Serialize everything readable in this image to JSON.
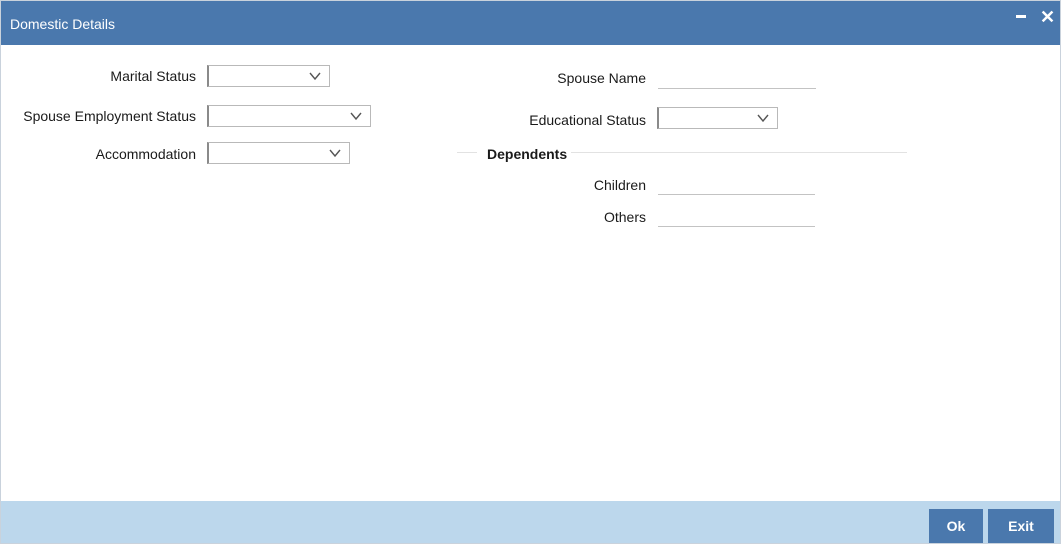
{
  "window": {
    "title": "Domestic Details"
  },
  "form": {
    "marital_status": {
      "label": "Marital Status",
      "value": ""
    },
    "spouse_employment_status": {
      "label": "Spouse Employment Status",
      "value": ""
    },
    "accommodation": {
      "label": "Accommodation",
      "value": ""
    },
    "spouse_name": {
      "label": "Spouse Name",
      "value": ""
    },
    "educational_status": {
      "label": "Educational Status",
      "value": ""
    }
  },
  "dependents": {
    "heading": "Dependents",
    "children": {
      "label": "Children",
      "value": ""
    },
    "others": {
      "label": "Others",
      "value": ""
    }
  },
  "footer": {
    "ok_label": "Ok",
    "exit_label": "Exit"
  },
  "colors": {
    "titlebar": "#4a78ad",
    "footer": "#bcd7ec",
    "button": "#4a78ad"
  }
}
